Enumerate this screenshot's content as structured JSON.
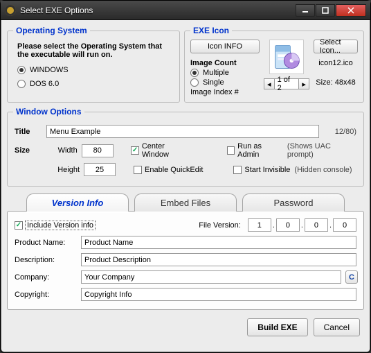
{
  "window": {
    "title": "Select EXE Options"
  },
  "os": {
    "legend": "Operating System",
    "prompt": "Please select the Operating System that the executable will run on.",
    "options": [
      "WINDOWS",
      "DOS 6.0"
    ],
    "selected": "WINDOWS"
  },
  "exeicon": {
    "legend": "EXE Icon",
    "info_button": "Icon INFO",
    "select_button": "Select Icon...",
    "filename": "icon12.ico",
    "image_count_label": "Image Count",
    "count_mode_options": [
      "Multiple",
      "Single"
    ],
    "count_mode_selected": "Multiple",
    "index_label": "Image Index #",
    "index_value": "1 of 2",
    "size_label": "Size: 48x48"
  },
  "winopt": {
    "legend": "Window Options",
    "title_label": "Title",
    "title_value": "Menu Example",
    "title_counter": "12/80)",
    "size_label": "Size",
    "width_label": "Width",
    "width_value": "80",
    "height_label": "Height",
    "height_value": "25",
    "center_window": {
      "label": "Center Window",
      "checked": true
    },
    "enable_quickedit": {
      "label": "Enable QuickEdit",
      "checked": false
    },
    "run_as_admin": {
      "label": "Run as Admin",
      "checked": false,
      "hint": "(Shows UAC prompt)"
    },
    "start_invisible": {
      "label": "Start Invisible",
      "checked": false,
      "hint": "(Hidden console)"
    }
  },
  "tabs": {
    "items": [
      "Version Info",
      "Embed Files",
      "Password"
    ],
    "active": "Version Info"
  },
  "version": {
    "include_label": "Include Version info",
    "include_checked": true,
    "file_version_label": "File Version:",
    "file_version": [
      "1",
      "0",
      "0",
      "0"
    ],
    "product_name_label": "Product Name:",
    "product_name": "Product Name",
    "description_label": "Description:",
    "description": "Product Description",
    "company_label": "Company:",
    "company": "Your Company",
    "copyright_label": "Copyright:",
    "copyright": "Copyright Info",
    "c_button": "C"
  },
  "footer": {
    "build": "Build EXE",
    "cancel": "Cancel"
  }
}
